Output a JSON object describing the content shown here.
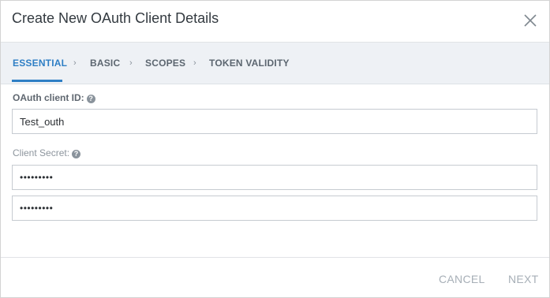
{
  "dialog": {
    "title": "Create New OAuth Client Details"
  },
  "tabs": [
    {
      "label": "ESSENTIAL",
      "active": true
    },
    {
      "label": "BASIC",
      "active": false
    },
    {
      "label": "SCOPES",
      "active": false
    },
    {
      "label": "TOKEN VALIDITY",
      "active": false
    }
  ],
  "tab_separator": "›",
  "form": {
    "client_id_label": "OAuth client ID:",
    "client_id_value": "Test_outh",
    "client_secret_label": "Client Secret:",
    "client_secret_value": "•••••••••",
    "client_secret_confirm_value": "•••••••••",
    "help_glyph": "?"
  },
  "footer": {
    "cancel_label": "CANCEL",
    "next_label": "NEXT"
  },
  "colors": {
    "accent": "#2f7fc5",
    "tab_bar": "#eef1f5",
    "disabled_text": "#a7afb7"
  },
  "icons": [
    "close-icon",
    "help-icon",
    "chevron-right-icon"
  ]
}
